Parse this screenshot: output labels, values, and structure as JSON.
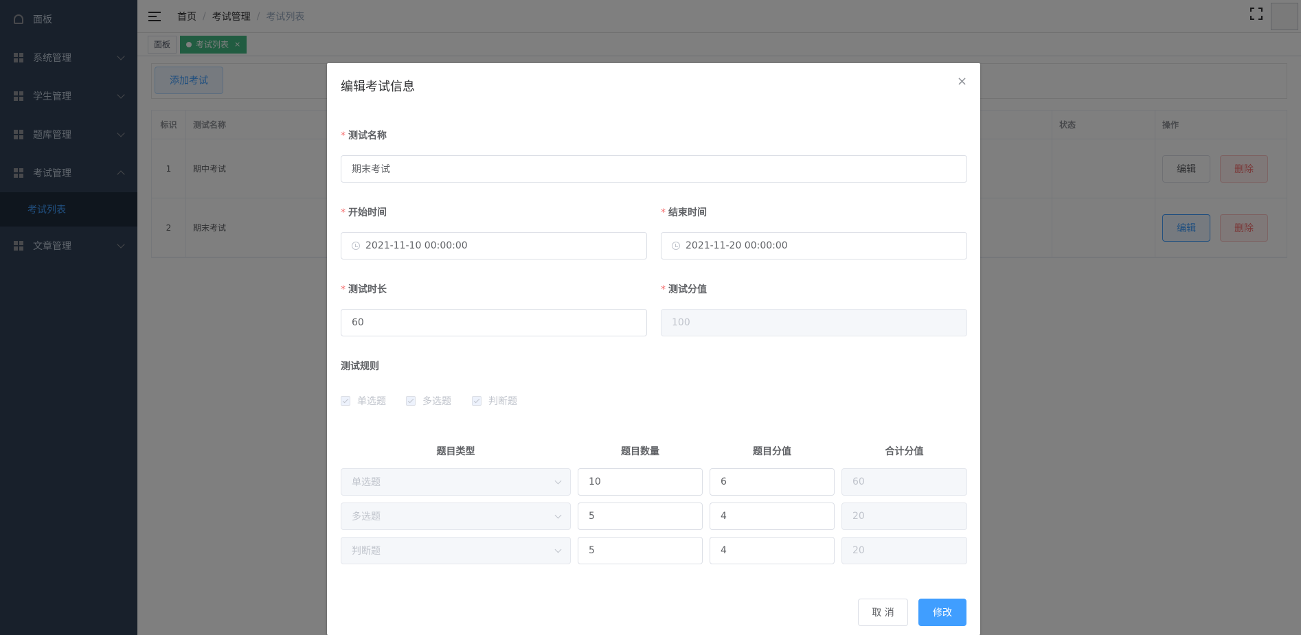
{
  "sidebar": {
    "dashboard": "面板",
    "items": [
      {
        "label": "系统管理"
      },
      {
        "label": "学生管理"
      },
      {
        "label": "题库管理"
      },
      {
        "label": "考试管理"
      },
      {
        "label": "文章管理"
      }
    ],
    "active_sub": "考试列表"
  },
  "navbar": {
    "breadcrumb": [
      "首页",
      "考试管理",
      "考试列表"
    ],
    "separator": "/"
  },
  "tags": {
    "home": "面板",
    "active": "考试列表",
    "close": "×"
  },
  "main": {
    "add_button": "添加考试",
    "table": {
      "headers": [
        "标识",
        "测试名称",
        "状态",
        "操作"
      ],
      "rows": [
        {
          "id": "1",
          "name": "期中考试"
        },
        {
          "id": "2",
          "name": "期末考试"
        }
      ],
      "edit_label": "编辑",
      "delete_label": "删除"
    }
  },
  "dialog": {
    "title": "编辑考试信息",
    "close": "×",
    "name_label": "测试名称",
    "name_value": "期末考试",
    "start_label": "开始时间",
    "start_value": "2021-11-10 00:00:00",
    "end_label": "结束时间",
    "end_value": "2021-11-20 00:00:00",
    "duration_label": "测试时长",
    "duration_value": "60",
    "score_label": "测试分值",
    "score_value": "100",
    "rules_label": "测试规则",
    "rule_options": [
      "单选题",
      "多选题",
      "判断题"
    ],
    "rule_headers": [
      "题目类型",
      "题目数量",
      "题目分值",
      "合计分值"
    ],
    "rule_rows": [
      {
        "type": "单选题",
        "count": "10",
        "score": "6",
        "total": "60"
      },
      {
        "type": "多选题",
        "count": "5",
        "score": "4",
        "total": "20"
      },
      {
        "type": "判断题",
        "count": "5",
        "score": "4",
        "total": "20"
      }
    ],
    "cancel": "取 消",
    "submit": "修改",
    "required_mark": "*"
  },
  "colors": {
    "sidebar_bg": "#304156",
    "primary": "#409eff",
    "tag_active": "#42b983",
    "danger": "#f56c6c"
  }
}
